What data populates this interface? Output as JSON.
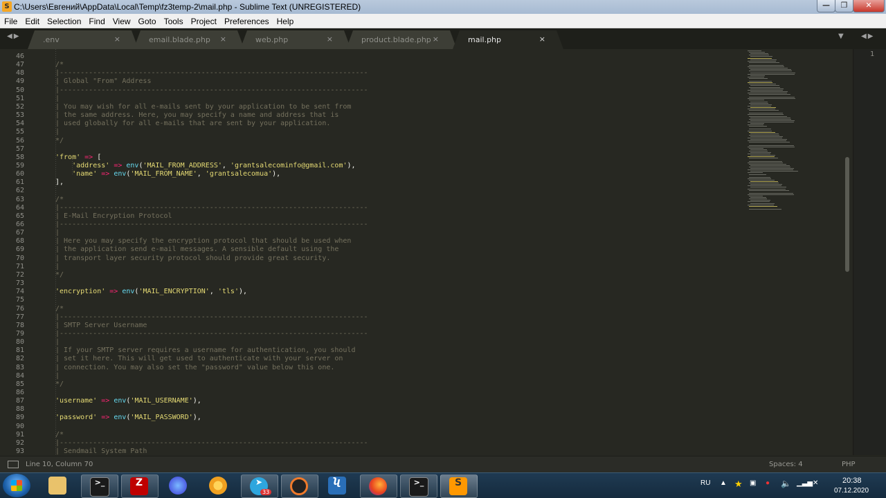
{
  "window": {
    "title": "C:\\Users\\Евгений\\AppData\\Local\\Temp\\fz3temp-2\\mail.php - Sublime Text (UNREGISTERED)",
    "minimize": "—",
    "maximize": "❐",
    "close": "✕"
  },
  "menu": [
    "File",
    "Edit",
    "Selection",
    "Find",
    "View",
    "Goto",
    "Tools",
    "Project",
    "Preferences",
    "Help"
  ],
  "tabs": [
    {
      "label": ".env",
      "close": "×"
    },
    {
      "label": "email.blade.php",
      "close": "×"
    },
    {
      "label": "web.php",
      "close": "×"
    },
    {
      "label": "product.blade.php",
      "close": "×"
    },
    {
      "label": "mail.php",
      "close": "×"
    }
  ],
  "tab_nav": {
    "left": "◀▶",
    "dropdown": "▼",
    "right": "◀▶"
  },
  "editor": {
    "line_numbers": [
      "46",
      "47",
      "48",
      "49",
      "50",
      "51",
      "52",
      "53",
      "54",
      "55",
      "56",
      "57",
      "58",
      "59",
      "60",
      "61",
      "62",
      "63",
      "64",
      "65",
      "66",
      "67",
      "68",
      "69",
      "70",
      "71",
      "72",
      "73",
      "74",
      "75",
      "76",
      "77",
      "78",
      "79",
      "80",
      "81",
      "82",
      "83",
      "84",
      "85",
      "86",
      "87",
      "88",
      "89",
      "90",
      "91",
      "92",
      "93"
    ],
    "lines": [
      "",
      "/*",
      "|--------------------------------------------------------------------------",
      "| Global \"From\" Address",
      "|--------------------------------------------------------------------------",
      "|",
      "| You may wish for all e-mails sent by your application to be sent from",
      "| the same address. Here, you may specify a name and address that is",
      "| used globally for all e-mails that are sent by your application.",
      "|",
      "*/",
      "",
      "'from' => [",
      "    'address' => env('MAIL_FROM_ADDRESS', 'grantsalecominfo@gmail.com'),",
      "    'name' => env('MAIL_FROM_NAME', 'grantsalecomua'),",
      "],",
      "",
      "/*",
      "|--------------------------------------------------------------------------",
      "| E-Mail Encryption Protocol",
      "|--------------------------------------------------------------------------",
      "|",
      "| Here you may specify the encryption protocol that should be used when",
      "| the application send e-mail messages. A sensible default using the",
      "| transport layer security protocol should provide great security.",
      "|",
      "*/",
      "",
      "'encryption' => env('MAIL_ENCRYPTION', 'tls'),",
      "",
      "/*",
      "|--------------------------------------------------------------------------",
      "| SMTP Server Username",
      "|--------------------------------------------------------------------------",
      "|",
      "| If your SMTP server requires a username for authentication, you should",
      "| set it here. This will get used to authenticate with your server on",
      "| connection. You may also set the \"password\" value below this one.",
      "|",
      "*/",
      "",
      "'username' => env('MAIL_USERNAME'),",
      "",
      "'password' => env('MAIL_PASSWORD'),",
      "",
      "/*",
      "|--------------------------------------------------------------------------",
      "| Sendmail System Path"
    ],
    "right_pane_line": "1"
  },
  "status": {
    "position": "Line 10, Column 70",
    "spaces": "Spaces: 4",
    "syntax": "PHP"
  },
  "taskbar": {
    "apps": [
      "explorer",
      "cmd",
      "filezilla",
      "firefox-dev",
      "chrome-canary",
      "telegram",
      "pomotodo",
      "vscode",
      "firefox",
      "terminal",
      "sublime"
    ],
    "telegram_badge": "33",
    "lang": "RU",
    "time": "20:38",
    "date": "07.12.2020"
  },
  "colors": {
    "bg": "#272822",
    "comment": "#75715e",
    "string": "#e6db74",
    "operator": "#f92672",
    "function": "#66d9ef"
  }
}
